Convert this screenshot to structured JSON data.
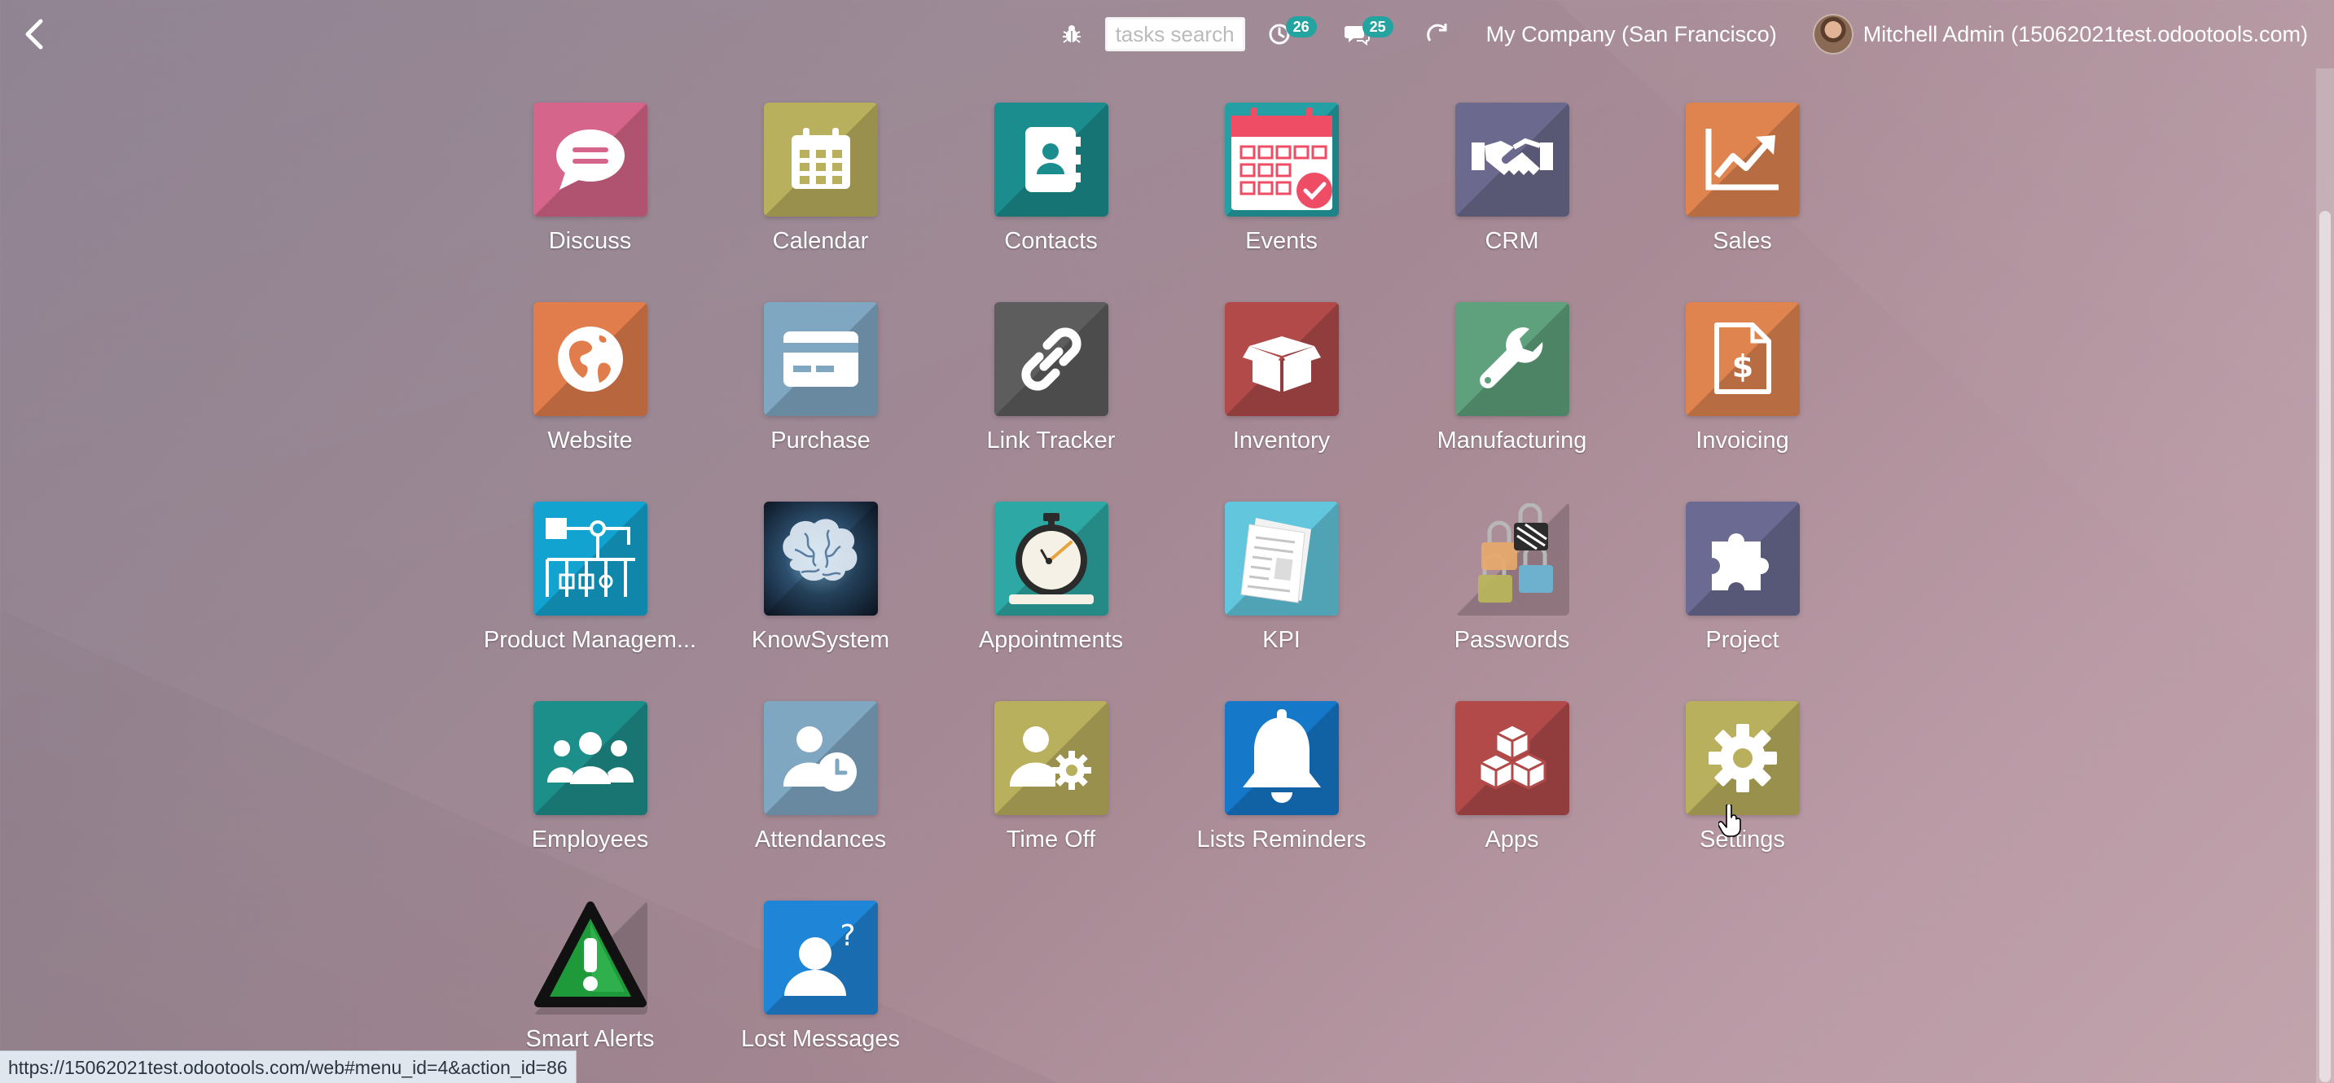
{
  "navbar": {
    "search_placeholder": "tasks search",
    "activity_badge": "26",
    "messages_badge": "25",
    "company": "My Company (San Francisco)",
    "user": "Mitchell Admin (15062021test.odootools.com)"
  },
  "apps": [
    {
      "label": "Discuss",
      "color": "#d5658a",
      "icon": "chat-bubble-icon"
    },
    {
      "label": "Calendar",
      "color": "#b9b05d",
      "icon": "calendar-icon"
    },
    {
      "label": "Contacts",
      "color": "#1b8d8f",
      "icon": "contact-book-icon"
    },
    {
      "label": "Events",
      "color": "#24a0a4",
      "icon": "event-calendar-icon"
    },
    {
      "label": "CRM",
      "color": "#6b6a8e",
      "icon": "handshake-icon"
    },
    {
      "label": "Sales",
      "color": "#e0844f",
      "icon": "chart-up-icon"
    },
    {
      "label": "Website",
      "color": "#e17d4c",
      "icon": "globe-icon"
    },
    {
      "label": "Purchase",
      "color": "#7fa7c2",
      "icon": "credit-card-icon"
    },
    {
      "label": "Link Tracker",
      "color": "#5d5d5d",
      "icon": "chain-link-icon"
    },
    {
      "label": "Inventory",
      "color": "#b24a4a",
      "icon": "open-box-icon"
    },
    {
      "label": "Manufacturing",
      "color": "#5fa17c",
      "icon": "wrench-icon"
    },
    {
      "label": "Invoicing",
      "color": "#e0844f",
      "icon": "invoice-dollar-icon"
    },
    {
      "label": "Product Managem...",
      "color": "#13a3d0",
      "icon": "org-tree-icon"
    },
    {
      "label": "KnowSystem",
      "color": "#1c2c3e",
      "icon": "brain-icon"
    },
    {
      "label": "Appointments",
      "color": "#2da8a4",
      "icon": "stopwatch-icon"
    },
    {
      "label": "KPI",
      "color": "#62c6dd",
      "icon": "newspaper-icon"
    },
    {
      "label": "Passwords",
      "color": "transparent",
      "icon": "padlocks-icon"
    },
    {
      "label": "Project",
      "color": "#6a6a92",
      "icon": "puzzle-piece-icon"
    },
    {
      "label": "Employees",
      "color": "#1d8f8b",
      "icon": "people-group-icon"
    },
    {
      "label": "Attendances",
      "color": "#7fa7c2",
      "icon": "user-clock-icon"
    },
    {
      "label": "Time Off",
      "color": "#b9b05d",
      "icon": "user-gear-icon"
    },
    {
      "label": "Lists Reminders",
      "color": "#1578c9",
      "icon": "bell-icon"
    },
    {
      "label": "Apps",
      "color": "#b24a4a",
      "icon": "cubes-icon"
    },
    {
      "label": "Settings",
      "color": "#b9b05d",
      "icon": "gear-icon"
    },
    {
      "label": "Smart Alerts",
      "color": "transparent",
      "icon": "warning-triangle-icon"
    },
    {
      "label": "Lost Messages",
      "color": "#1f85d6",
      "icon": "user-question-icon"
    }
  ],
  "status_url": "https://15062021test.odootools.com/web#menu_id=4&action_id=86"
}
